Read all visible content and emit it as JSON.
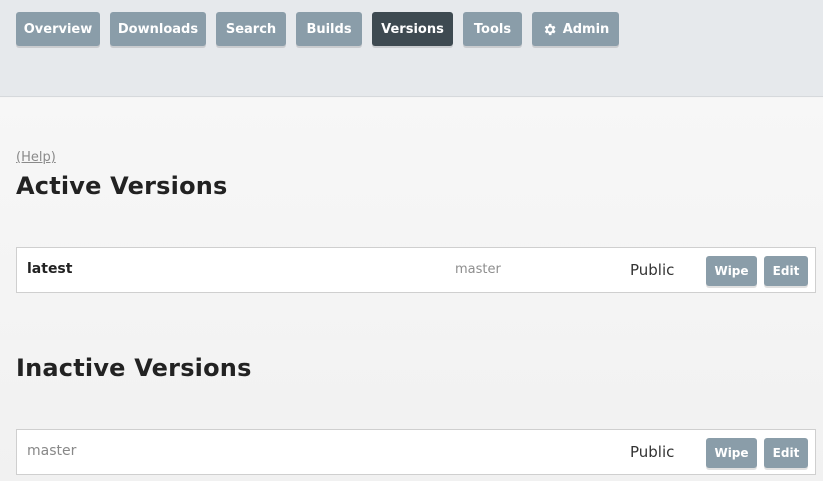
{
  "nav": {
    "tabs": [
      {
        "label": "Overview",
        "active": false
      },
      {
        "label": "Downloads",
        "active": false
      },
      {
        "label": "Search",
        "active": false
      },
      {
        "label": "Builds",
        "active": false
      },
      {
        "label": "Versions",
        "active": true
      },
      {
        "label": "Tools",
        "active": false
      },
      {
        "label": "Admin",
        "active": false,
        "icon": "gear-icon"
      }
    ]
  },
  "help_link": "(Help)",
  "active_section": {
    "title": "Active Versions",
    "rows": [
      {
        "name": "latest",
        "branch": "master",
        "privacy": "Public",
        "wipe_label": "Wipe",
        "edit_label": "Edit"
      }
    ]
  },
  "inactive_section": {
    "title": "Inactive Versions",
    "rows": [
      {
        "name": "master",
        "branch": "",
        "privacy": "Public",
        "wipe_label": "Wipe",
        "edit_label": "Edit"
      }
    ]
  },
  "colors": {
    "tab_bg": "#8a9da9",
    "tab_active_bg": "#3e4a51",
    "header_bg": "#e6e9ec"
  }
}
